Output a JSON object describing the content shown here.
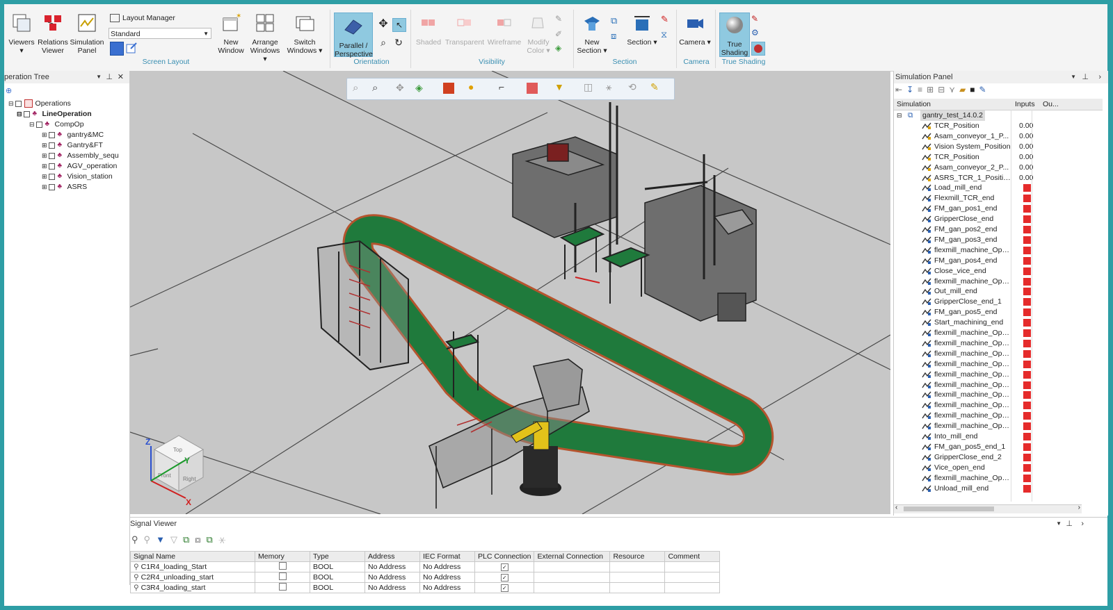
{
  "ribbon": {
    "buttons": [
      {
        "label": "Viewers",
        "arrow": "▾"
      },
      {
        "label": "Relations Viewer"
      },
      {
        "label": "Simulation Panel"
      },
      {
        "label": "New Window"
      },
      {
        "label": "Arrange Windows ▾"
      },
      {
        "label": "Switch Windows ▾"
      },
      {
        "label": "Parallel / Perspective"
      },
      {
        "label": "Shaded"
      },
      {
        "label": "Transparent"
      },
      {
        "label": "Wireframe"
      },
      {
        "label": "Modify Color ▾"
      },
      {
        "label": "New Section ▾"
      },
      {
        "label": "Section ▾"
      },
      {
        "label": "Camera ▾"
      },
      {
        "label": "True Shading"
      }
    ],
    "layout_manager_label": "Layout Manager",
    "layout_select_value": "Standard",
    "groups": [
      "Screen Layout",
      "Orientation",
      "Visibility",
      "Section",
      "Camera",
      "True Shading"
    ]
  },
  "operation_tree": {
    "title": "peration Tree",
    "items": [
      {
        "label": "Operations",
        "bold": false
      },
      {
        "label": "LineOperation",
        "bold": true
      },
      {
        "label": "CompOp",
        "bold": false
      },
      {
        "label": "gantry&MC",
        "bold": false
      },
      {
        "label": "Gantry&FT",
        "bold": false
      },
      {
        "label": "Assembly_sequ",
        "bold": false
      },
      {
        "label": "AGV_operation",
        "bold": false
      },
      {
        "label": "Vision_station",
        "bold": false
      },
      {
        "label": "ASRS",
        "bold": false
      }
    ]
  },
  "viewport": {
    "axis_labels": {
      "x": "X",
      "y": "Y",
      "z": "Z"
    },
    "cube_faces": {
      "top": "Top",
      "front": "Front",
      "right": "Right"
    },
    "colors": {
      "floor": "#c7c7c7",
      "track": "#1f7a3c",
      "track_edge": "#b5542e"
    }
  },
  "simulation_panel": {
    "title": "Simulation Panel",
    "columns": [
      "Simulation",
      "Inputs",
      "Ou..."
    ],
    "root": "gantry_test_14.0.2",
    "rows": [
      {
        "name": "TCR_Position",
        "value": "0.00"
      },
      {
        "name": "Asam_conveyor_1_P...",
        "value": "0.00"
      },
      {
        "name": "Vision System_Position",
        "value": "0.00"
      },
      {
        "name": "TCR_Position",
        "value": "0.00"
      },
      {
        "name": "Asam_conveyor_2_P...",
        "value": "0.00"
      },
      {
        "name": "ASRS_TCR_1_Position",
        "value": "0.00"
      },
      {
        "name": "Load_mill_end",
        "value": ""
      },
      {
        "name": "Flexmill_TCR_end",
        "value": ""
      },
      {
        "name": "FM_gan_pos1_end",
        "value": ""
      },
      {
        "name": "GripperClose_end",
        "value": ""
      },
      {
        "name": "FM_gan_pos2_end",
        "value": ""
      },
      {
        "name": "FM_gan_pos3_end",
        "value": ""
      },
      {
        "name": "flexmill_machine_Op1...",
        "value": ""
      },
      {
        "name": "FM_gan_pos4_end",
        "value": ""
      },
      {
        "name": "Close_vice_end",
        "value": ""
      },
      {
        "name": "flexmill_machine_Op1...",
        "value": ""
      },
      {
        "name": "Out_mill_end",
        "value": ""
      },
      {
        "name": "GripperClose_end_1",
        "value": ""
      },
      {
        "name": "FM_gan_pos5_end",
        "value": ""
      },
      {
        "name": "Start_machining_end",
        "value": ""
      },
      {
        "name": "flexmill_machine_Op1...",
        "value": ""
      },
      {
        "name": "flexmill_machine_Op1...",
        "value": ""
      },
      {
        "name": "flexmill_machine_Op1...",
        "value": ""
      },
      {
        "name": "flexmill_machine_Op1...",
        "value": ""
      },
      {
        "name": "flexmill_machine_Op1...",
        "value": ""
      },
      {
        "name": "flexmill_machine_Op1...",
        "value": ""
      },
      {
        "name": "flexmill_machine_Op1...",
        "value": ""
      },
      {
        "name": "flexmill_machine_Op1...",
        "value": ""
      },
      {
        "name": "flexmill_machine_Op1...",
        "value": ""
      },
      {
        "name": "flexmill_machine_Op1...",
        "value": ""
      },
      {
        "name": "Into_mill_end",
        "value": ""
      },
      {
        "name": "FM_gan_pos5_end_1",
        "value": ""
      },
      {
        "name": "GripperClose_end_2",
        "value": ""
      },
      {
        "name": "Vice_open_end",
        "value": ""
      },
      {
        "name": "flexmill_machine_Op1...",
        "value": ""
      },
      {
        "name": "Unload_mill_end",
        "value": ""
      }
    ]
  },
  "signal_viewer": {
    "title": "Signal Viewer",
    "columns": [
      "Signal Name",
      "Memory",
      "Type",
      "Address",
      "IEC Format",
      "PLC Connection",
      "External Connection",
      "Resource",
      "Comment"
    ],
    "rows": [
      {
        "name": "C1R4_loading_Start",
        "type": "BOOL",
        "address": "No Address",
        "iec": "No Address"
      },
      {
        "name": "C2R4_unloading_start",
        "type": "BOOL",
        "address": "No Address",
        "iec": "No Address"
      },
      {
        "name": "C3R4_loading_start",
        "type": "BOOL",
        "address": "No Address",
        "iec": "No Address"
      }
    ]
  }
}
